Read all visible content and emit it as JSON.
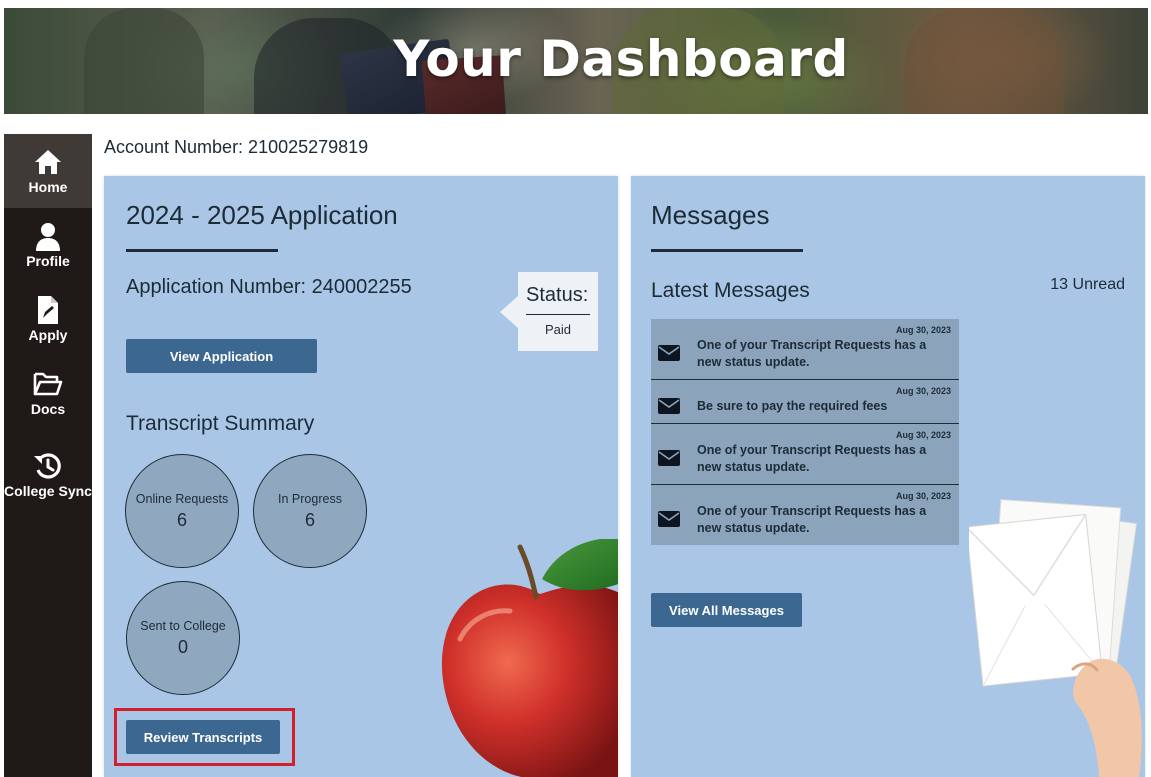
{
  "hero": {
    "title": "Your Dashboard"
  },
  "sidebar": {
    "items": [
      {
        "label": "Home",
        "icon": "home-icon",
        "active": true
      },
      {
        "label": "Profile",
        "icon": "user-icon",
        "active": false
      },
      {
        "label": "Apply",
        "icon": "document-edit-icon",
        "active": false
      },
      {
        "label": "Docs",
        "icon": "folder-open-icon",
        "active": false
      },
      {
        "label": "College Sync",
        "icon": "history-icon",
        "active": false
      }
    ]
  },
  "account": {
    "label": "Account Number: 210025279819"
  },
  "application": {
    "title": "2024 - 2025 Application",
    "number_label": "Application Number: 240002255",
    "status_label": "Status:",
    "status_value": "Paid",
    "view_button": "View Application",
    "transcript_summary": {
      "title": "Transcript Summary",
      "stats": [
        {
          "label": "Online Requests",
          "value": "6"
        },
        {
          "label": "In Progress",
          "value": "6"
        },
        {
          "label": "Sent to College",
          "value": "0"
        }
      ]
    },
    "review_button": "Review Transcripts"
  },
  "messages": {
    "title": "Messages",
    "latest_title": "Latest Messages",
    "unread": "13 Unread",
    "items": [
      {
        "date": "Aug 30, 2023",
        "text": "One of your Transcript Requests has a new status update."
      },
      {
        "date": "Aug 30, 2023",
        "text": "Be sure to pay the required fees"
      },
      {
        "date": "Aug 30, 2023",
        "text": "One of your Transcript Requests has a new status update."
      },
      {
        "date": "Aug 30, 2023",
        "text": "One of your Transcript Requests has a new status update."
      }
    ],
    "view_all_button": "View All Messages"
  },
  "colors": {
    "sidebar_bg": "#1f1a17",
    "card_bg": "#a9c6e6",
    "button_bg": "#3b6790",
    "highlight": "#d21f2a"
  }
}
